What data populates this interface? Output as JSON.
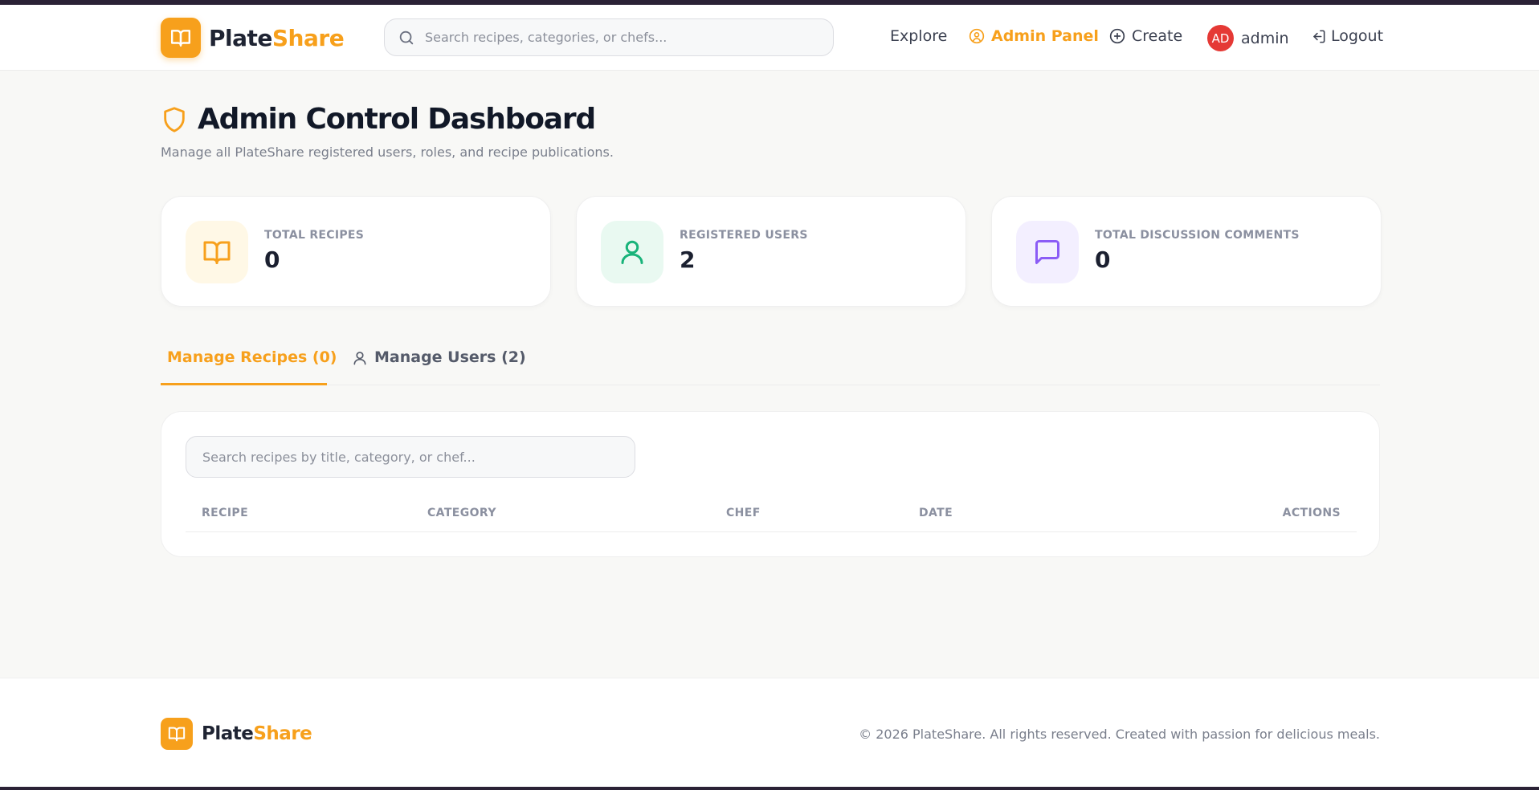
{
  "brand": {
    "name_part1": "Plate",
    "name_part2": "Share",
    "accent": "#f7a01c"
  },
  "header": {
    "search_placeholder": "Search recipes, categories, or chefs...",
    "nav": {
      "explore": "Explore",
      "admin_panel": "Admin Panel",
      "create": "Create",
      "avatar_initials": "AD",
      "username": "admin",
      "logout": "Logout"
    }
  },
  "page": {
    "title": "Admin Control Dashboard",
    "subtitle": "Manage all PlateShare registered users, roles, and recipe publications."
  },
  "stats": [
    {
      "label": "TOTAL RECIPES",
      "value": "0",
      "icon": "book-open-icon",
      "color": "#f7a01c",
      "bg": "#fff8e6"
    },
    {
      "label": "REGISTERED USERS",
      "value": "2",
      "icon": "user-icon",
      "color": "#19b37a",
      "bg": "#e9f9f1"
    },
    {
      "label": "TOTAL DISCUSSION COMMENTS",
      "value": "0",
      "icon": "message-square-icon",
      "color": "#8b5cf6",
      "bg": "#f3efff"
    }
  ],
  "tabs": [
    {
      "label": "Manage Recipes (0)",
      "icon": "book-open-icon",
      "active": true
    },
    {
      "label": "Manage Users (2)",
      "icon": "user-icon",
      "active": false
    }
  ],
  "recipes_panel": {
    "search_placeholder": "Search recipes by title, category, or chef...",
    "columns": [
      "RECIPE",
      "CATEGORY",
      "CHEF",
      "DATE",
      "ACTIONS"
    ]
  },
  "footer": {
    "copyright": "© 2026 PlateShare. All rights reserved. Created with passion for delicious meals."
  }
}
